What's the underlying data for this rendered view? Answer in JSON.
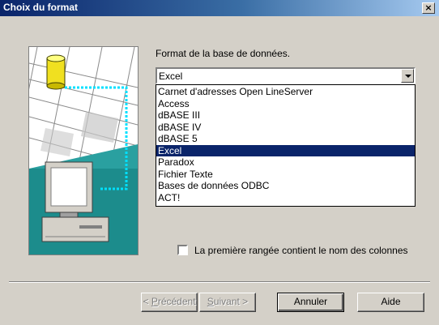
{
  "window": {
    "title": "Choix du format",
    "close_glyph": "×"
  },
  "format": {
    "label": "Format de la base de données.",
    "selected_value": "Excel",
    "options": [
      "Carnet d'adresses Open LineServer",
      "Access",
      "dBASE III",
      "dBASE IV",
      "dBASE 5",
      "Excel",
      "Paradox",
      "Fichier Texte",
      "Bases de données ODBC",
      "ACT!"
    ],
    "highlighted_index": 5
  },
  "checkbox": {
    "label": "La première rangée contient le nom des colonnes",
    "checked": false
  },
  "buttons": {
    "back": {
      "pre": "< ",
      "mnemonic": "P",
      "rest": "récédent"
    },
    "next": {
      "mnemonic": "S",
      "rest": "uivant >"
    },
    "cancel": "Annuler",
    "help": "Aide"
  },
  "colors": {
    "title_bar": "#0a246a",
    "highlight": "#0a246a",
    "dialog_bg": "#d4d0c8",
    "illustration_teal": "#1c8c8c",
    "cylinder_yellow": "#f0e020",
    "dotted_link": "#00e0ff"
  },
  "icons": [
    "close-icon",
    "dropdown-arrow-icon",
    "database-cylinder-icon",
    "computer-icon"
  ]
}
